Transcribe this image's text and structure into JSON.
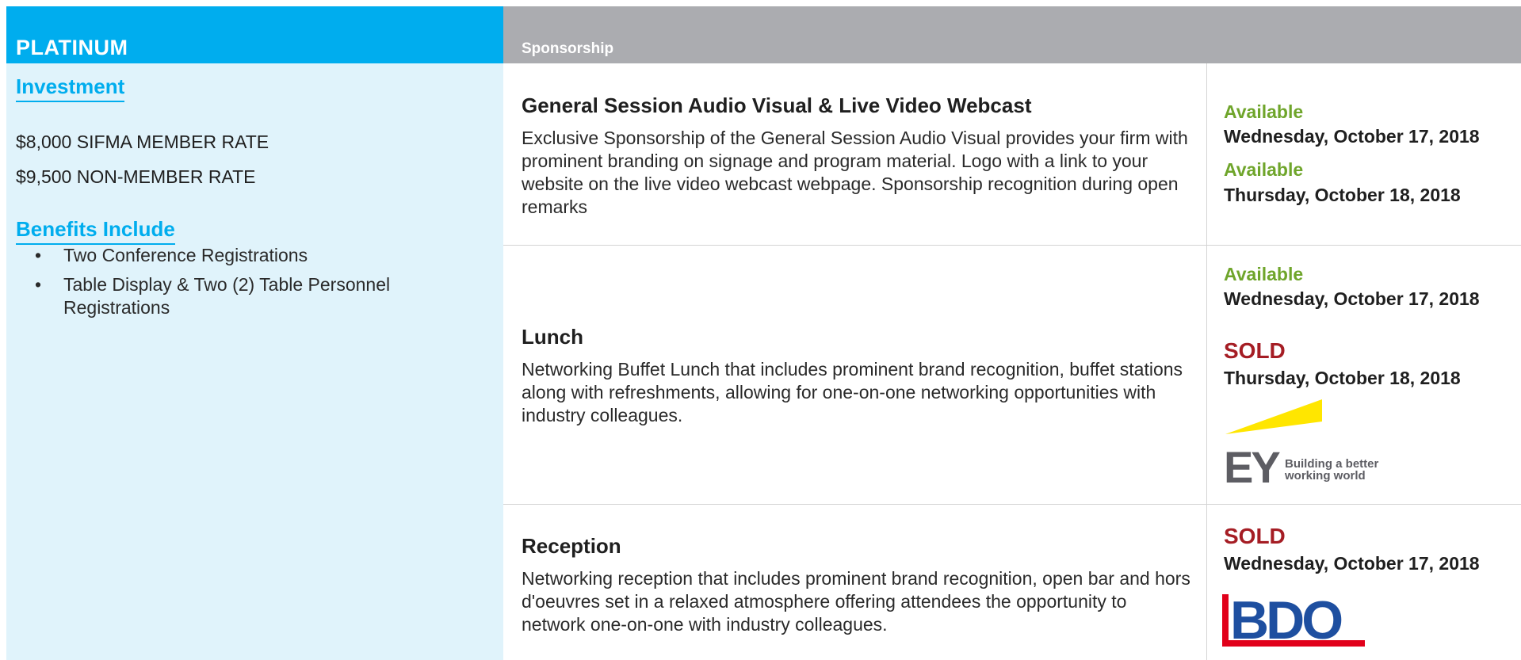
{
  "left": {
    "tier": "PLATINUM",
    "investment_heading": "Investment",
    "member_rate": "$8,000 SIFMA MEMBER RATE",
    "non_member_rate": "$9,500 NON-MEMBER RATE",
    "benefits_heading": "Benefits Include",
    "benefits": [
      "Two Conference Registrations",
      "Table Display & Two (2) Table Personnel Registrations"
    ]
  },
  "header": {
    "sponsorship_label": "Sponsorship"
  },
  "rows": [
    {
      "title": "General Session Audio Visual & Live Video Webcast",
      "description": "Exclusive Sponsorship of the General Session Audio Visual provides your firm with prominent branding on signage and program material. Logo with a link to your website on the live video webcast webpage. Sponsorship recognition during open remarks",
      "slots": [
        {
          "status": "Available",
          "date": "Wednesday, October 17, 2018"
        },
        {
          "status": "Available",
          "date": "Thursday, October 18, 2018"
        }
      ]
    },
    {
      "title": "Lunch",
      "description": "Networking Buffet Lunch that includes prominent brand recognition, buffet stations along with refreshments, allowing for one-on-one networking opportunities with industry colleagues.",
      "slots": [
        {
          "status": "Available",
          "date": "Wednesday, October 17, 2018"
        },
        {
          "status": "SOLD",
          "date": "Thursday, October 18, 2018"
        }
      ],
      "sponsor_logo": {
        "brand": "EY",
        "tagline_line1": "Building a better",
        "tagline_line2": "working world"
      }
    },
    {
      "title": "Reception",
      "description": "Networking reception that includes prominent brand recognition, open bar and hors d'oeuvres set in a relaxed atmosphere offering attendees the opportunity to network one-on-one with industry colleagues.",
      "slots": [
        {
          "status": "SOLD",
          "date": "Wednesday, October 17, 2018"
        }
      ],
      "sponsor_logo": {
        "brand": "BDO"
      }
    }
  ],
  "colors": {
    "tier_blue": "#00adee",
    "panel_light_blue": "#e0f3fb",
    "header_grey": "#abacb0",
    "available_green": "#6fa52b",
    "sold_red": "#a51d24",
    "ey_yellow": "#ffe600",
    "ey_grey": "#5d5d63",
    "bdo_blue": "#1e4fa0",
    "bdo_red": "#e1001a"
  }
}
